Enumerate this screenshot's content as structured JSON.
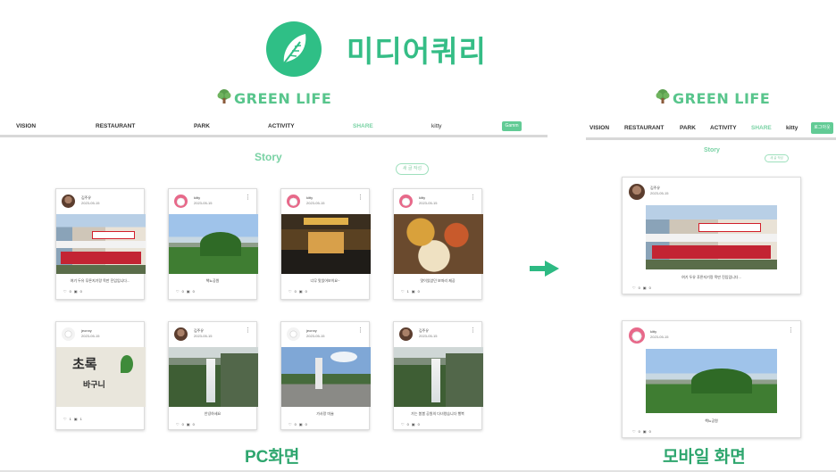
{
  "title": "미디어쿼리",
  "brand": "GREEN LIFE",
  "pc": {
    "nav": [
      "VISION",
      "RESTAURANT",
      "PARK",
      "ACTIVITY",
      "SHARE",
      "kitty"
    ],
    "nav_button": "Gamm",
    "story": "Story",
    "write_button": "새 글 작성",
    "label": "PC화면",
    "cards": [
      {
        "avatar": "person",
        "user": "김주유",
        "date": "2023-05-15",
        "photo": "street",
        "caption": "여기 두유 푸른지기랑 목만 진입입니다...",
        "likes": "0",
        "comments": "0"
      },
      {
        "avatar": "kitty",
        "user": "kitty",
        "date": "2023-05-15",
        "photo": "hill",
        "caption": "책뇨공원",
        "likes": "0",
        "comments": "0"
      },
      {
        "avatar": "kitty",
        "user": "kitty",
        "date": "2023-05-15",
        "photo": "cafe",
        "caption": "너무 맛있어보이요~",
        "likes": "0",
        "comments": "0"
      },
      {
        "avatar": "kitty",
        "user": "kitty",
        "date": "2023-05-15",
        "photo": "food",
        "caption": "맛이있었던 보따리 제공",
        "likes": "1",
        "comments": "0"
      },
      {
        "avatar": "jeony",
        "user": "jeonny",
        "date": "2023-05-15",
        "photo": "sign",
        "caption": "",
        "likes": "1",
        "comments": "1"
      },
      {
        "avatar": "person",
        "user": "김주유",
        "date": "2023-05-15",
        "photo": "fall",
        "caption": "안녕하세요",
        "likes": "0",
        "comments": "0"
      },
      {
        "avatar": "jeony",
        "user": "jeonny",
        "date": "2023-05-15",
        "photo": "town",
        "caption": "가사랑 미술",
        "likes": "0",
        "comments": "0"
      },
      {
        "avatar": "person",
        "user": "김주유",
        "date": "2023-05-15",
        "photo": "fall",
        "caption": "가는 봄봄 공원의 다녀왔습니다 행복",
        "likes": "0",
        "comments": "0"
      }
    ]
  },
  "mobile": {
    "nav": [
      "VISION",
      "RESTAURANT",
      "PARK",
      "ACTIVITY",
      "SHARE",
      "kitty"
    ],
    "nav_button": "로그아웃",
    "story": "Story",
    "write_button": "새 글 작성",
    "label": "모바일 화면",
    "cards": [
      {
        "avatar": "person",
        "user": "김주유",
        "date": "2023-05-15",
        "photo": "street",
        "caption": "여기 두유 푸른지기랑 목만 진입입니다...",
        "likes": "0",
        "comments": "0"
      },
      {
        "avatar": "kitty",
        "user": "kitty",
        "date": "2023-05-15",
        "photo": "hill",
        "caption": "책뇨공원",
        "likes": "0",
        "comments": "0"
      }
    ]
  },
  "colors": {
    "accent": "#2fbf86",
    "brand": "#58c58c",
    "active_nav": "#79d2a4",
    "label": "#2ea66e"
  },
  "icons": {
    "logo": "leaf-icon",
    "brand": "tree-icon",
    "like": "heart-icon",
    "comment": "comment-icon",
    "menu": "kebab-icon",
    "arrow": "arrow-right-icon"
  }
}
